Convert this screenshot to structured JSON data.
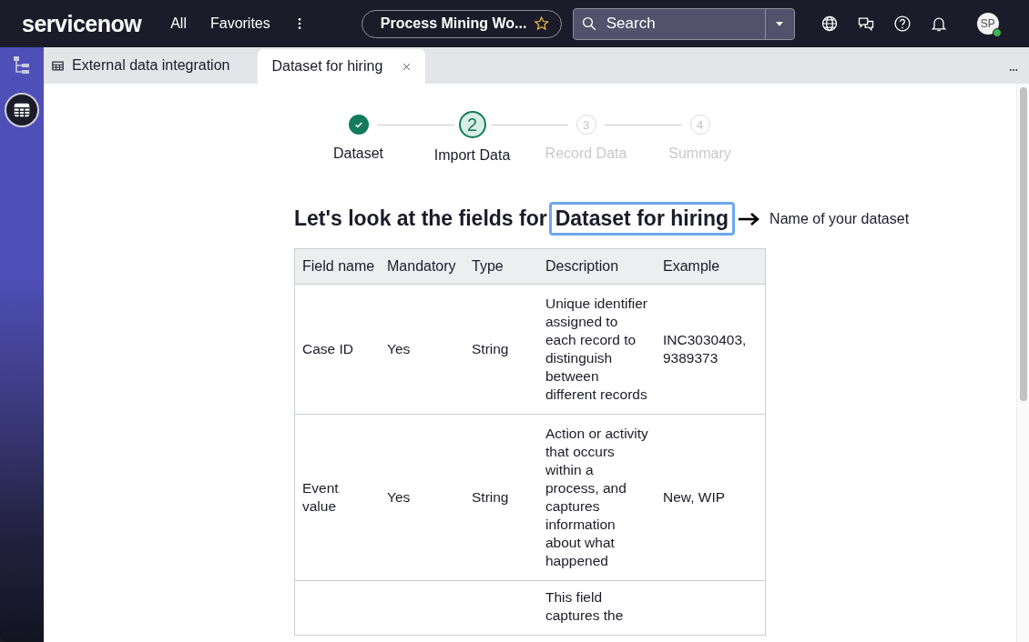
{
  "topbar": {
    "logo": "servicenow",
    "nav": [
      "All",
      "Favorites"
    ],
    "workspace": {
      "label": "Process Mining Wo...",
      "starred": false
    },
    "search": {
      "placeholder": "Search"
    },
    "avatar": "SP"
  },
  "tabs": [
    {
      "label": "External data integration",
      "selected": false,
      "kind": "table"
    },
    {
      "label": "Dataset for hiring",
      "selected": true,
      "kind": "closable"
    }
  ],
  "steps": [
    {
      "label": "Dataset",
      "completed": true,
      "selected": false
    },
    {
      "number": "2",
      "label": "Import Data",
      "completed": false,
      "selected": true
    },
    {
      "number": "3",
      "label": "Record Data",
      "completed": false,
      "selected": false
    },
    {
      "number": "4",
      "label": "Summary",
      "completed": false,
      "selected": false
    }
  ],
  "heading": {
    "prefix": "Let's look at the fields for",
    "dataset_name": "Dataset for hiring"
  },
  "annotation": {
    "label": "Name of your dataset"
  },
  "table": {
    "columns": [
      "Field name",
      "Mandatory",
      "Type",
      "Description",
      "Example"
    ],
    "rows": [
      [
        "Case ID",
        "Yes",
        "String",
        "Unique identifier assigned to each record to distinguish between different records",
        "INC3030403, 9389373"
      ],
      [
        "Event value",
        "Yes",
        "String",
        "Action or activity that occurs within a process, and captures information about what happened",
        "New, WIP"
      ],
      [
        "",
        "",
        "",
        "This field captures the",
        ""
      ]
    ]
  }
}
